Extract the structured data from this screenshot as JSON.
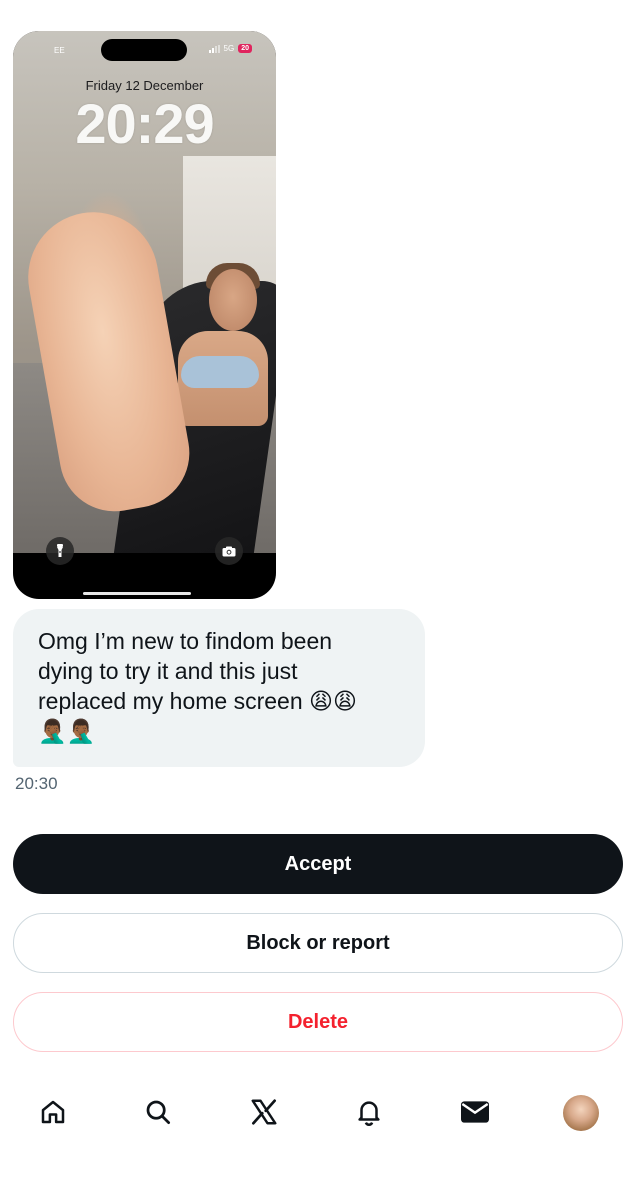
{
  "screenshot": {
    "carrier": "EE",
    "network": "5G",
    "battery": "20",
    "date": "Friday 12 December",
    "time": "20:29",
    "left_button_icon": "flashlight-icon",
    "right_button_icon": "camera-icon"
  },
  "message": {
    "text": "Omg I’m new to findom been\ndying to try it and this just\nreplaced my home screen 😩😩\n🤦🏾‍♂️🤦🏾‍♂️",
    "timestamp": "20:30"
  },
  "actions": {
    "accept_label": "Accept",
    "block_label": "Block or report",
    "delete_label": "Delete"
  },
  "colors": {
    "accept_bg": "#0f1419",
    "delete_text": "#f4212e",
    "bubble_bg": "#eff3f4",
    "timestamp": "#536471"
  },
  "nav": {
    "items": [
      "home-icon",
      "search-icon",
      "x-logo-icon",
      "notifications-bell-icon",
      "messages-envelope-icon",
      "profile-avatar"
    ]
  }
}
